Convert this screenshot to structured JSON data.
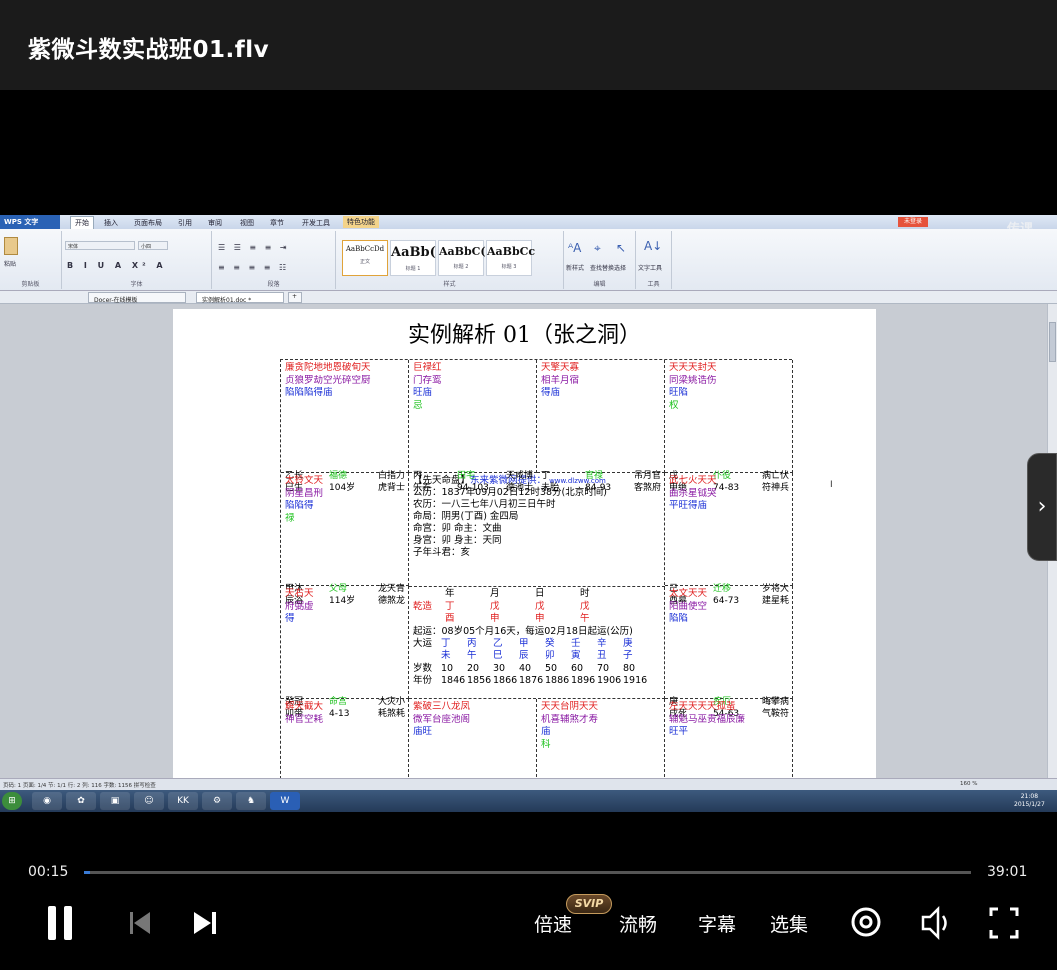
{
  "player": {
    "title": "紫微斗数实战班01.flv",
    "current_time": "00:15",
    "total_time": "39:01",
    "progress_fraction": 0.0064,
    "controls": {
      "speed": "倍速",
      "svip_badge": "SVIP",
      "quality": "流畅",
      "subtitles": "字幕",
      "episodes": "选集"
    },
    "watermark": "传课"
  },
  "wps": {
    "app_name": "WPS 文字",
    "menu_tabs": [
      "开始",
      "插入",
      "页面布局",
      "引用",
      "审阅",
      "视图",
      "章节",
      "开发工具",
      "特色功能"
    ],
    "login_label": "未登录",
    "ribbon": {
      "font_name": "宋体",
      "font_size": "小四",
      "styles": [
        {
          "sample": "AaBbCcDd",
          "name": "正文"
        },
        {
          "sample": "AaBb(",
          "name": "标题 1"
        },
        {
          "sample": "AaBbC(",
          "name": "标题 2"
        },
        {
          "sample": "AaBbCc",
          "name": "标题 3"
        }
      ],
      "groups": [
        "剪贴板",
        "字体",
        "段落",
        "样式",
        "编辑",
        "工具"
      ],
      "buttons": [
        "粘贴",
        "新样式",
        "查找替换",
        "选择",
        "文字工具"
      ]
    },
    "doc_tabs": [
      "Docer-在线模板",
      "实例解析01.doc *"
    ],
    "status": "页码: 1  页面: 1/4  节: 1/1  行: 2  列: 116  字数: 1156  拼写检查",
    "zoom": "160 %",
    "clock": {
      "time": "21:08",
      "date": "2015/1/27"
    }
  },
  "chart_doc": {
    "title": "实例解析 01（张之洞）",
    "cells": [
      {
        "lines": [
          {
            "text": "廉贪陀地地恩破旬天",
            "color": "r"
          },
          {
            "text": "贞狼罗劫空光碎空厨",
            "color": "p"
          },
          {
            "text": "陷陷陷得庙",
            "color": "b"
          }
        ],
        "bottom": [
          [
            "乙长",
            "巳生"
          ],
          [
            "福德",
            "104岁"
          ],
          [
            "白指力",
            "虎背士"
          ]
        ]
      },
      {
        "lines": [
          {
            "text": "巨禄红",
            "color": "r"
          },
          {
            "text": "门存鸾",
            "color": "p"
          },
          {
            "text": "旺庙",
            "color": "b"
          },
          {
            "text": "忌",
            "color": "g"
          }
        ],
        "bottom": [
          [
            "丙",
            "午养"
          ],
          [
            "田宅",
            "94-103"
          ],
          [
            "天咸博",
            "德池士"
          ]
        ]
      },
      {
        "lines": [
          {
            "text": "天擎天寡",
            "color": "r"
          },
          {
            "text": "相羊月宿",
            "color": "p"
          },
          {
            "text": "得庙",
            "color": "b"
          }
        ],
        "bottom": [
          [
            "丁",
            "未胎"
          ],
          [
            "官禄",
            "84-93"
          ],
          [
            "吊月官",
            "客煞府"
          ]
        ]
      },
      {
        "lines": [
          {
            "text": "天天天封天",
            "color": "r"
          },
          {
            "text": "同梁姚诰伤",
            "color": "p"
          },
          {
            "text": "旺陷",
            "color": "b"
          },
          {
            "text": "权",
            "color": "g"
          }
        ],
        "bottom": [
          [
            "戊",
            "申绝"
          ],
          [
            "仆役",
            "74-83"
          ],
          [
            "病亡伏",
            "符神兵"
          ]
        ]
      },
      {
        "lines": [
          {
            "text": "太铃文天",
            "color": "r"
          },
          {
            "text": "阴星昌刑",
            "color": "p"
          },
          {
            "text": "陷陷得",
            "color": "b"
          },
          {
            "text": "禄",
            "color": "g"
          }
        ],
        "bottom": [
          [
            "甲沐",
            "辰浴"
          ],
          [
            "父母",
            "114岁"
          ],
          [
            "龙天青",
            "德煞龙"
          ]
        ]
      },
      {
        "lines": [
          {
            "text": "武七火天天",
            "color": "r"
          },
          {
            "text": "曲杀星钺哭",
            "color": "p"
          },
          {
            "text": "平旺得庙",
            "color": "b"
          }
        ],
        "bottom": [
          [
            "己",
            "酉墓"
          ],
          [
            "迁移",
            "64-73"
          ],
          [
            "岁将大",
            "建星耗"
          ]
        ]
      },
      {
        "lines": [
          {
            "text": "天右天",
            "color": "r"
          },
          {
            "text": "府弼虚",
            "color": "p"
          },
          {
            "text": "得",
            "color": "b"
          }
        ],
        "bottom": [
          [
            "癸冠",
            "卯带"
          ],
          [
            "命宫",
            "4-13"
          ],
          [
            "大灾小",
            "耗煞耗"
          ]
        ]
      },
      {
        "lines": [
          {
            "text": "太文天天",
            "color": "r"
          },
          {
            "text": "阳曲使空",
            "color": "p"
          },
          {
            "text": "陷陷",
            "color": "b"
          }
        ],
        "bottom": [
          [
            "庚",
            "戌死"
          ],
          [
            "疾厄",
            "54-63"
          ],
          [
            "晦攀病",
            "气鞍符"
          ]
        ]
      },
      {
        "lines": [
          {
            "text": "解天截大",
            "color": "r"
          },
          {
            "text": "神官空耗",
            "color": "p"
          }
        ],
        "bottom": []
      },
      {
        "lines": [
          {
            "text": "紫破三八龙凤",
            "color": "r"
          },
          {
            "text": "微军台座池阁",
            "color": "p"
          },
          {
            "text": "庙旺",
            "color": "b"
          }
        ],
        "bottom": []
      },
      {
        "lines": [
          {
            "text": "天天台阴天天",
            "color": "r"
          },
          {
            "text": "机喜辅煞才寿",
            "color": "p"
          },
          {
            "text": "庙",
            "color": "b"
          },
          {
            "text": "科",
            "color": "g"
          }
        ],
        "bottom": []
      },
      {
        "lines": [
          {
            "text": "左天天天天孤蜚",
            "color": "r"
          },
          {
            "text": "辅魁马巫贵福辰廉",
            "color": "p"
          },
          {
            "text": "  旺平",
            "color": "b"
          }
        ],
        "bottom": []
      }
    ],
    "center": {
      "header_a": "【先天命盘】",
      "header_b": "东来紫微网提供：",
      "header_url": "www.dlzww.com",
      "info": [
        "公历：1837年09月02日12时38分(北京时间)",
        "农历：一八三七年八月初三日午时",
        "命局：阴男(丁酉)  金四局",
        "命宫：卯    命主：文曲",
        "身宫：卯    身主：天同",
        "子年斗君：亥"
      ],
      "pillar_headers": [
        "年",
        "月",
        "日",
        "时"
      ],
      "pillar_label": "乾造",
      "stems": [
        "丁",
        "戊",
        "戊",
        "戊"
      ],
      "branches": [
        "酉",
        "申",
        "申",
        "午"
      ],
      "qiyun": "起运：08岁05个月16天，每运02月18日起运(公历)",
      "dayun_label": "大运",
      "dayun_stems": [
        "丁",
        "丙",
        "乙",
        "甲",
        "癸",
        "壬",
        "辛",
        "庚"
      ],
      "dayun_branches": [
        "未",
        "午",
        "巳",
        "辰",
        "卯",
        "寅",
        "丑",
        "子"
      ],
      "age_label": "岁数",
      "ages": [
        "10",
        "20",
        "30",
        "40",
        "50",
        "60",
        "70",
        "80"
      ],
      "year_label": "年份",
      "years": [
        "1846",
        "1856",
        "1866",
        "1876",
        "1886",
        "1896",
        "1906",
        "1916"
      ]
    }
  }
}
